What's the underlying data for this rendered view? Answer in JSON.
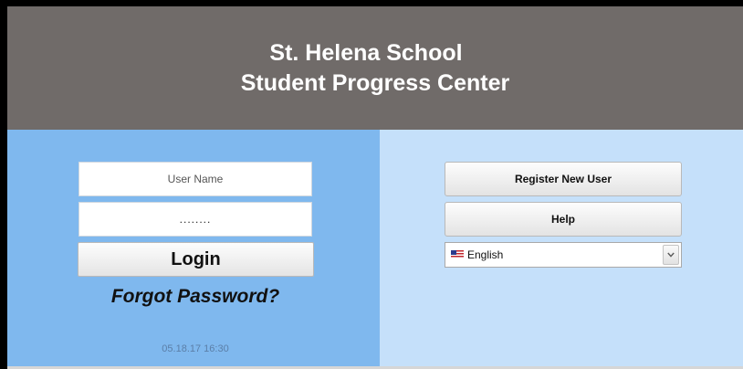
{
  "header": {
    "line1": "St. Helena School",
    "line2": "Student Progress Center"
  },
  "login": {
    "username_placeholder": "User Name",
    "password_value": "........",
    "login_label": "Login",
    "forgot_label": "Forgot Password?",
    "timestamp": "05.18.17 16:30"
  },
  "actions": {
    "register_label": "Register New User",
    "help_label": "Help"
  },
  "language": {
    "selected": "English",
    "flag_icon": "us-flag-icon",
    "arrow_icon": "chevron-down-icon"
  },
  "colors": {
    "header_bg": "#706b69",
    "left_panel_bg": "#7fb8ee",
    "right_panel_bg": "#c5e0fa"
  }
}
